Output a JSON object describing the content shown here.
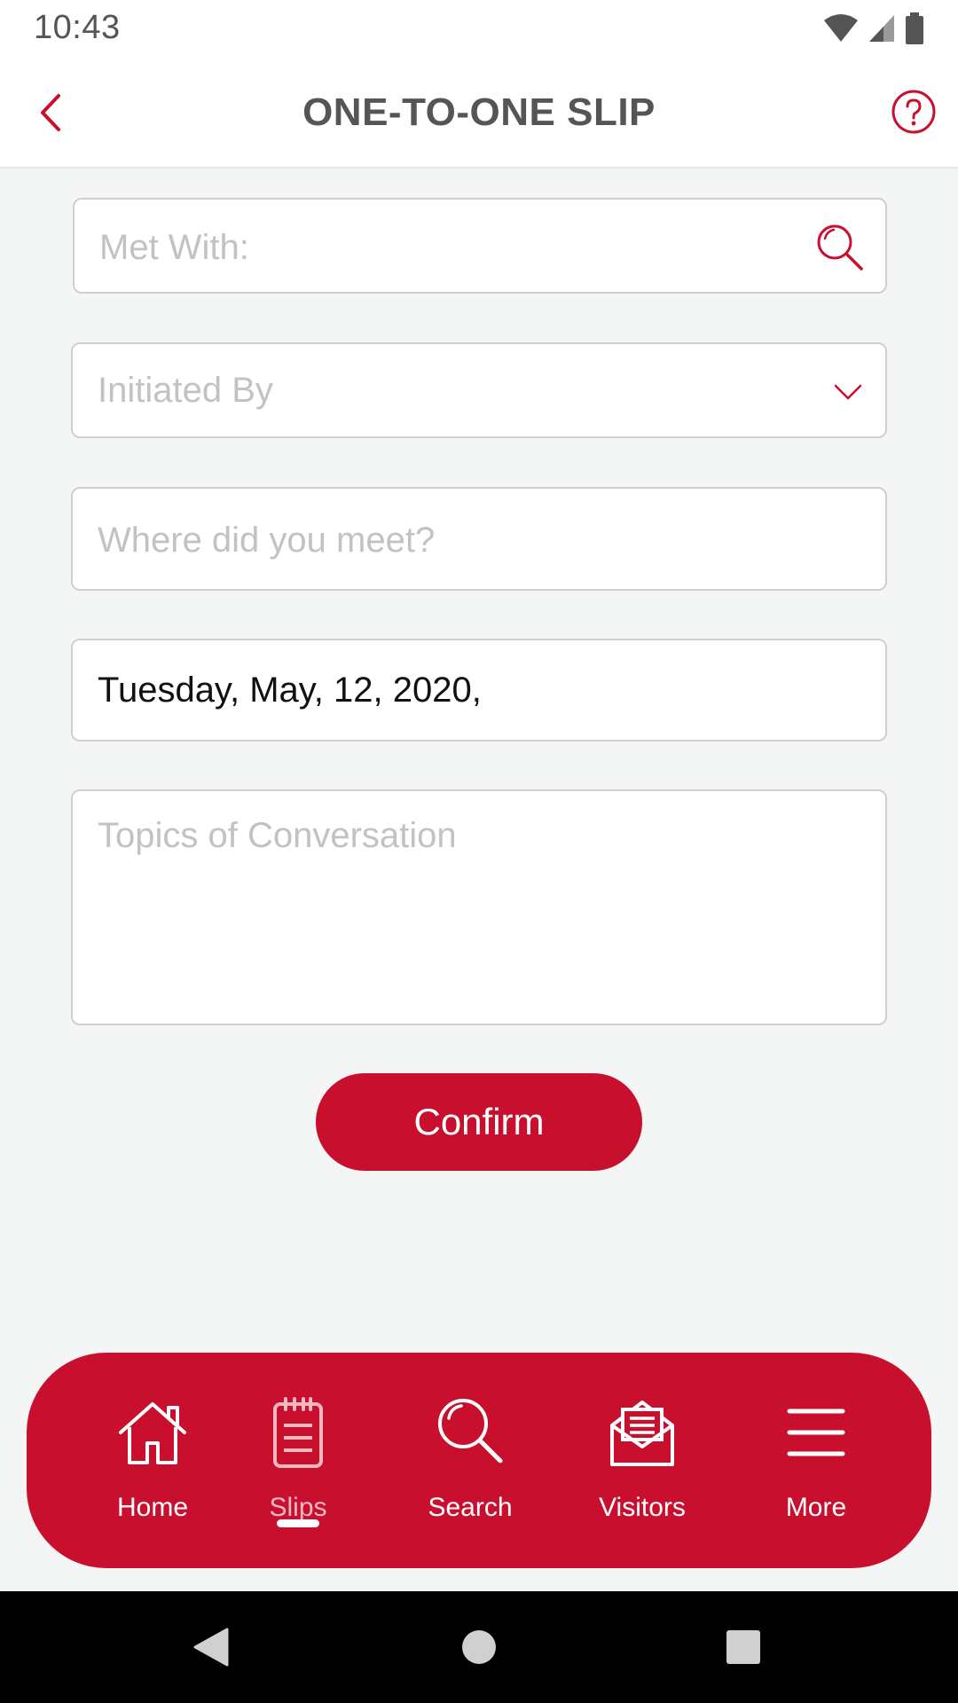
{
  "status_bar": {
    "time": "10:43",
    "icons": [
      "wifi-icon",
      "cell-signal-icon",
      "battery-icon"
    ]
  },
  "header": {
    "title": "ONE-TO-ONE SLIP",
    "back_icon": "chevron-left-icon",
    "help_icon": "help-circle-icon"
  },
  "form": {
    "met_with": {
      "placeholder": "Met With:",
      "value": "",
      "icon": "search-icon"
    },
    "initiated_by": {
      "placeholder": "Initiated By",
      "icon": "chevron-down-icon"
    },
    "where_met": {
      "placeholder": "Where did you meet?",
      "value": ""
    },
    "date": {
      "value": "Tuesday, May, 12, 2020,"
    },
    "topics": {
      "placeholder": "Topics of Conversation",
      "value": ""
    },
    "confirm_label": "Confirm"
  },
  "bottom_nav": {
    "items": [
      {
        "label": "Home",
        "icon": "home-icon",
        "active": false
      },
      {
        "label": "Slips",
        "icon": "clipboard-icon",
        "active": true
      },
      {
        "label": "Search",
        "icon": "search-icon",
        "active": false
      },
      {
        "label": "Visitors",
        "icon": "mail-open-icon",
        "active": false
      },
      {
        "label": "More",
        "icon": "menu-icon",
        "active": false
      }
    ]
  },
  "system_nav": [
    "back-triangle-icon",
    "home-circle-icon",
    "recents-square-icon"
  ],
  "colors": {
    "brand_red": "#c8102e",
    "background": "#f4f5f5",
    "placeholder": "#c2c2c2",
    "title_gray": "#555555"
  }
}
